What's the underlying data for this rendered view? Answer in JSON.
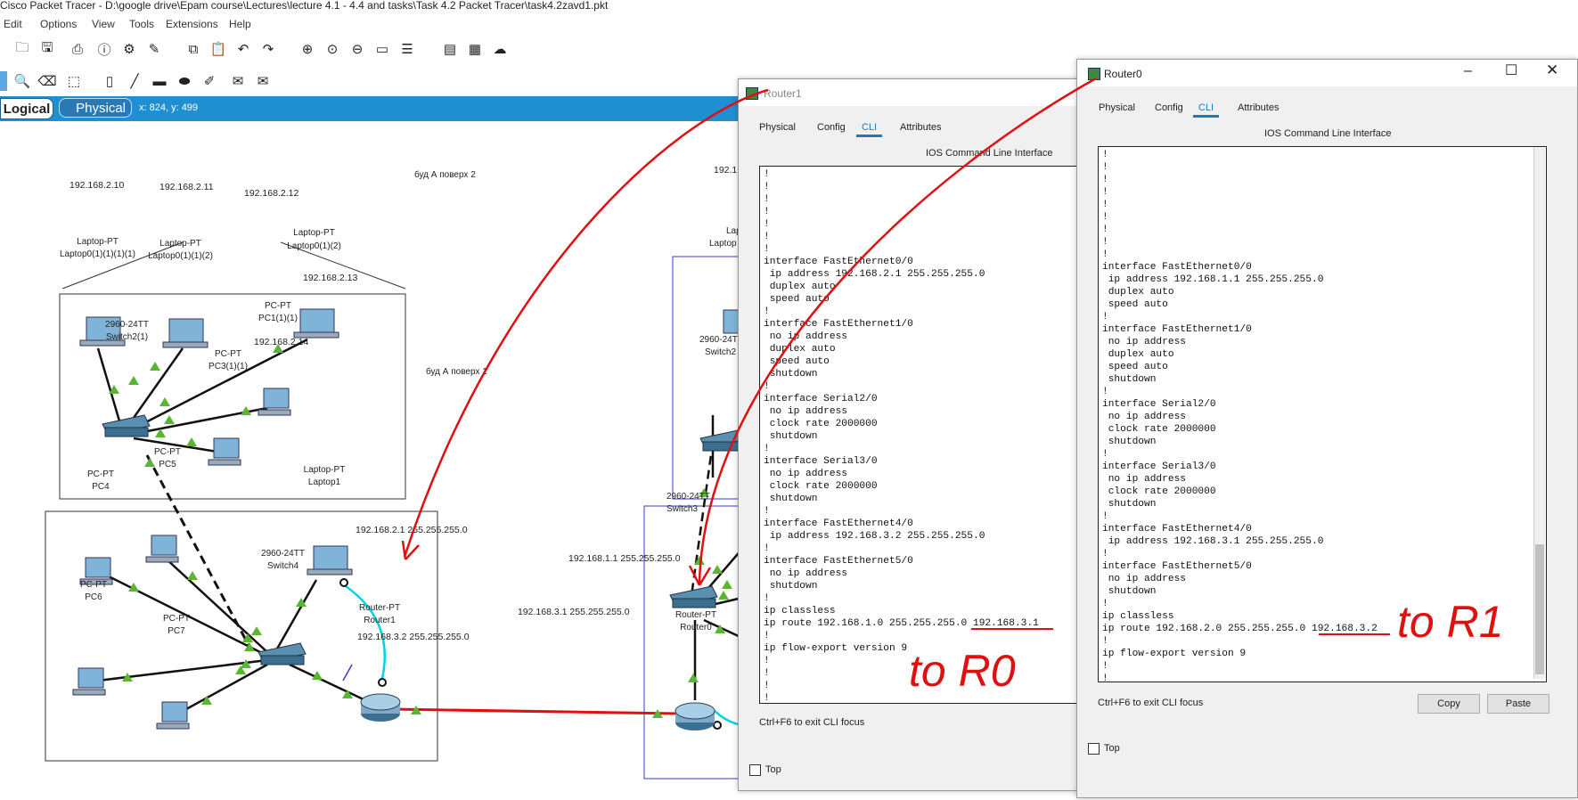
{
  "app": {
    "title": "Cisco Packet Tracer - D:\\google drive\\Epam course\\Lectures\\lecture 4.1 - 4.4 and tasks\\Task 4.2 Packet Tracer\\task4.2zavd1.pkt"
  },
  "menu": [
    "Edit",
    "Options",
    "View",
    "Tools",
    "Extensions",
    "Help"
  ],
  "workspace": {
    "logical_tab": "Logical",
    "physical_tab": "Physical",
    "coords": "x: 824, y: 499"
  },
  "topology": {
    "area2_label": "буд А поверх 2",
    "area1_label": "буд А поверх 1",
    "devices": [
      {
        "type": "Laptop-PT",
        "name": "Laptop0(1)(1)(1)(1)",
        "ip": "192.168.2.10"
      },
      {
        "type": "Laptop-PT",
        "name": "Laptop0(1)(1)(2)",
        "ip": "192.168.2.11"
      },
      {
        "type": "Laptop-PT",
        "name": "Laptop0(1)(2)",
        "ip": "192.168.2.12"
      },
      {
        "type": "PC-PT",
        "name": "PC1(1)(1)",
        "ip": "192.168.2.13"
      },
      {
        "type": "PC-PT",
        "name": "PC3(1)(1)",
        "ip": "192.168.2.14"
      },
      {
        "type": "2960-24TT",
        "name": "Switch2(1)"
      },
      {
        "type": "PC-PT",
        "name": "PC4"
      },
      {
        "type": "PC-PT",
        "name": "PC5"
      },
      {
        "type": "Laptop-PT",
        "name": "Laptop1"
      },
      {
        "type": "2960-24TT",
        "name": "Switch4"
      },
      {
        "type": "PC-PT",
        "name": "PC6"
      },
      {
        "type": "PC-PT",
        "name": "PC7"
      },
      {
        "type": "Router-PT",
        "name": "Router1"
      },
      {
        "type": "Router-PT",
        "name": "Router0"
      },
      {
        "type": "2960-24TT",
        "name": "Switch3"
      },
      {
        "type": "2960-24TT",
        "name": "Switch2"
      }
    ],
    "ip_labels": [
      "192.168.2.1 255.255.255.0",
      "192.168.3.2 255.255.255.0",
      "192.168.1.1 255.255.255.0",
      "192.168.3.1 255.255.255.0"
    ],
    "partial_labels": [
      "192.1",
      "Lap",
      "Laptop",
      "2960-24T",
      "Switch2"
    ]
  },
  "router1_window": {
    "title": "Router1",
    "tabs": [
      "Physical",
      "Config",
      "CLI",
      "Attributes"
    ],
    "active_tab": "CLI",
    "heading": "IOS Command Line Interface",
    "cli_lines": [
      "!",
      "!",
      "!",
      "!",
      "!",
      "!",
      "!",
      "interface FastEthernet0/0",
      " ip address 192.168.2.1 255.255.255.0",
      " duplex auto",
      " speed auto",
      "!",
      "interface FastEthernet1/0",
      " no ip address",
      " duplex auto",
      " speed auto",
      " shutdown",
      "!",
      "interface Serial2/0",
      " no ip address",
      " clock rate 2000000",
      " shutdown",
      "!",
      "interface Serial3/0",
      " no ip address",
      " clock rate 2000000",
      " shutdown",
      "!",
      "interface FastEthernet4/0",
      " ip address 192.168.3.2 255.255.255.0",
      "!",
      "interface FastEthernet5/0",
      " no ip address",
      " shutdown",
      "!",
      "ip classless",
      "ip route 192.168.1.0 255.255.255.0 192.168.3.1",
      "!",
      "ip flow-export version 9",
      "!",
      "!",
      "!",
      "!"
    ],
    "hint": "Ctrl+F6 to exit CLI focus",
    "top_checkbox": "Top",
    "annotation": "to R0"
  },
  "router0_window": {
    "title": "Router0",
    "tabs": [
      "Physical",
      "Config",
      "CLI",
      "Attributes"
    ],
    "active_tab": "CLI",
    "heading": "IOS Command Line Interface",
    "cli_lines": [
      "!",
      "!",
      "!",
      "!",
      "!",
      "!",
      "!",
      "!",
      "!",
      "interface FastEthernet0/0",
      " ip address 192.168.1.1 255.255.255.0",
      " duplex auto",
      " speed auto",
      "!",
      "interface FastEthernet1/0",
      " no ip address",
      " duplex auto",
      " speed auto",
      " shutdown",
      "!",
      "interface Serial2/0",
      " no ip address",
      " clock rate 2000000",
      " shutdown",
      "!",
      "interface Serial3/0",
      " no ip address",
      " clock rate 2000000",
      " shutdown",
      "!",
      "interface FastEthernet4/0",
      " ip address 192.168.3.1 255.255.255.0",
      "!",
      "interface FastEthernet5/0",
      " no ip address",
      " shutdown",
      "!",
      "ip classless",
      "ip route 192.168.2.0 255.255.255.0 192.168.3.2",
      "!",
      "ip flow-export version 9",
      "!",
      "!",
      "!",
      "!",
      "!"
    ],
    "hint": "Ctrl+F6 to exit CLI focus",
    "copy_button": "Copy",
    "paste_button": "Paste",
    "top_checkbox": "Top",
    "annotation": "to R1"
  },
  "colors": {
    "accent_blue": "#1f8fd1",
    "annotation_red": "#e01010",
    "link_green": "#5cb531"
  }
}
